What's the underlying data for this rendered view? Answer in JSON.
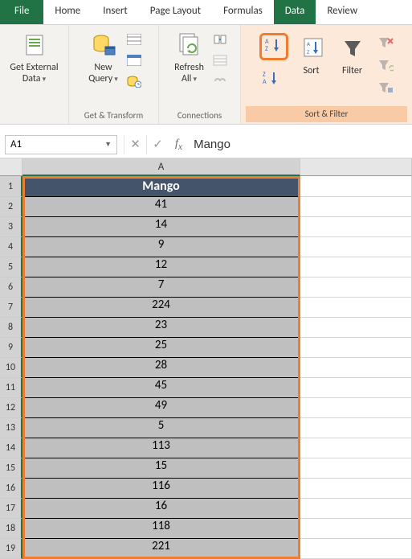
{
  "menubar": {
    "file": "File",
    "tabs": [
      "Home",
      "Insert",
      "Page Layout",
      "Formulas",
      "Data",
      "Review"
    ],
    "active": "Data"
  },
  "ribbon": {
    "get_external_data": {
      "label": "Get External\nData"
    },
    "get_transform": {
      "new_query": "New\nQuery",
      "group_label": "Get & Transform"
    },
    "connections": {
      "refresh_all": "Refresh\nAll",
      "group_label": "Connections"
    },
    "sort_filter": {
      "sort": "Sort",
      "filter": "Filter",
      "group_label": "Sort & Filter"
    }
  },
  "namebox": {
    "value": "A1"
  },
  "formula_bar": {
    "value": "Mango"
  },
  "chart_data": {
    "type": "table",
    "header": "Mango",
    "values": [
      41,
      14,
      9,
      12,
      7,
      224,
      23,
      25,
      28,
      45,
      49,
      5,
      113,
      15,
      116,
      16,
      118,
      221
    ]
  },
  "grid": {
    "columns": [
      "A"
    ],
    "selected_range": "A1:A19"
  }
}
